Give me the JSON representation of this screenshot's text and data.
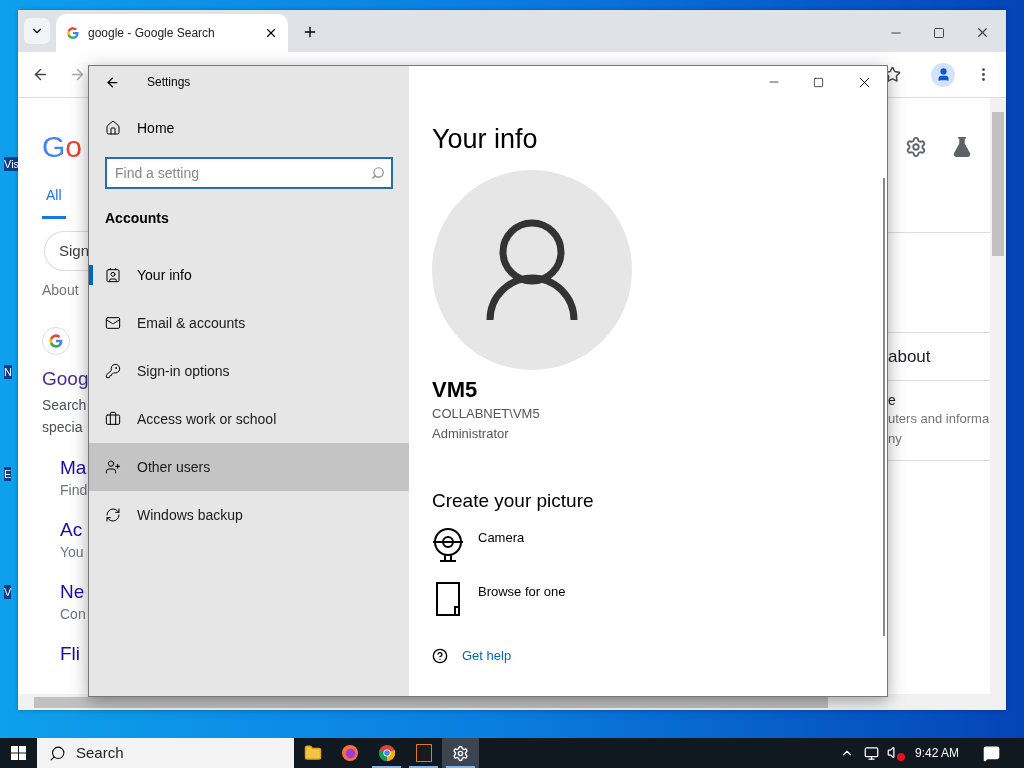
{
  "desktop": {
    "icon_labels": [
      "Vis",
      "N",
      "E",
      "V"
    ]
  },
  "browser": {
    "tab": {
      "title": "google - Google Search"
    },
    "page_left": {
      "logo": "Go",
      "tabs": [
        {
          "label": "All",
          "selected": true
        }
      ],
      "sign_in": "Sign",
      "about": "About",
      "result": {
        "title": "Goog",
        "snippet": [
          "Search",
          "specia"
        ]
      },
      "sitelinks": [
        {
          "title": "Ma",
          "snippet": "Find"
        },
        {
          "title": "Ac",
          "snippet": "You"
        },
        {
          "title": "Ne",
          "snippet": "Con"
        },
        {
          "title": "Fli"
        }
      ]
    },
    "page_right": {
      "heading": "about",
      "result": {
        "title": "e",
        "snippet": [
          "uters and informa",
          "ny"
        ]
      }
    }
  },
  "settings": {
    "title": "Settings",
    "home": "Home",
    "search": {
      "placeholder": "Find a setting"
    },
    "section": "Accounts",
    "nav": [
      {
        "label": "Your info",
        "selected": true,
        "hovered": false
      },
      {
        "label": "Email & accounts",
        "selected": false,
        "hovered": false
      },
      {
        "label": "Sign-in options",
        "selected": false,
        "hovered": false
      },
      {
        "label": "Access work or school",
        "selected": false,
        "hovered": false
      },
      {
        "label": "Other users",
        "selected": false,
        "hovered": true
      },
      {
        "label": "Windows backup",
        "selected": false,
        "hovered": false
      }
    ],
    "page": {
      "title": "Your info",
      "name": "VM5",
      "account": "COLLABNET\\VM5",
      "role": "Administrator",
      "subtitle": "Create your picture",
      "options": [
        {
          "label": "Camera"
        },
        {
          "label": "Browse for one"
        }
      ],
      "help": "Get help"
    }
  },
  "taskbar": {
    "search": "Search",
    "apps": [
      {
        "kind": "files",
        "running": false,
        "active": false
      },
      {
        "kind": "firefox",
        "running": false,
        "active": false
      },
      {
        "kind": "chrome",
        "running": true,
        "active": false
      },
      {
        "kind": "app",
        "running": true,
        "active": false
      },
      {
        "kind": "settings",
        "running": false,
        "active": true
      }
    ],
    "volume_muted": true,
    "time": "9:42 AM"
  }
}
